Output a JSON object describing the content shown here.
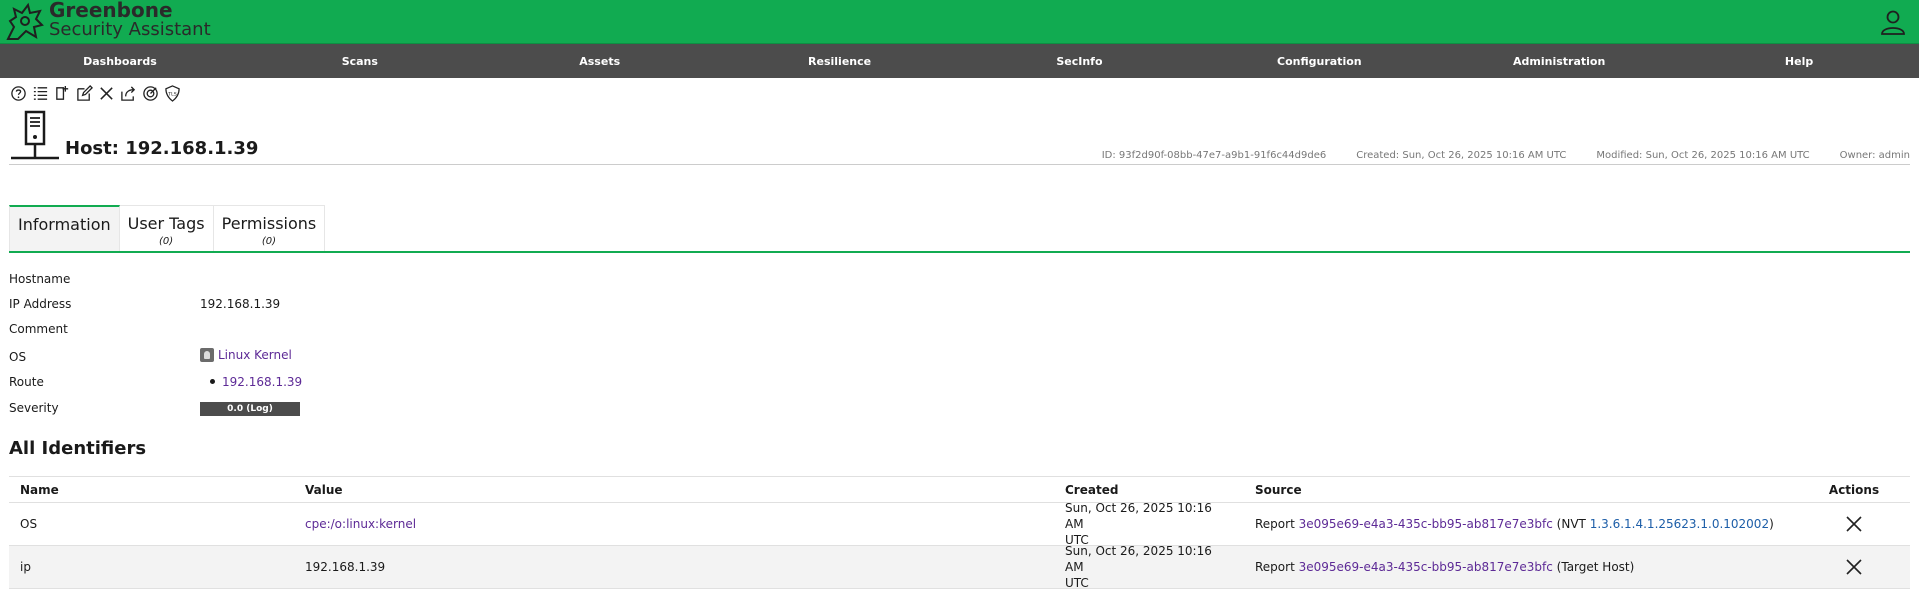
{
  "app": {
    "logo_line1": "Greenbone",
    "logo_line2": "Security Assistant"
  },
  "nav": [
    "Dashboards",
    "Scans",
    "Assets",
    "Resilience",
    "SecInfo",
    "Configuration",
    "Administration",
    "Help"
  ],
  "toolbar": [
    "help-icon",
    "list-icon",
    "new-icon",
    "edit-icon",
    "delete-icon",
    "export-icon",
    "results-icon",
    "tls-certificate-icon"
  ],
  "header": {
    "title": "Host: 192.168.1.39",
    "id": "ID: 93f2d90f-08bb-47e7-a9b1-91f6c44d9de6",
    "created": "Created: Sun, Oct 26, 2025 10:16 AM UTC",
    "modified": "Modified: Sun, Oct 26, 2025 10:16 AM UTC",
    "owner": "Owner: admin"
  },
  "tabs": [
    {
      "label": "Information",
      "count": ""
    },
    {
      "label": "User Tags",
      "count": "(0)"
    },
    {
      "label": "Permissions",
      "count": "(0)"
    }
  ],
  "info": {
    "hostname_label": "Hostname",
    "hostname_value": "",
    "ip_label": "IP Address",
    "ip_value": "192.168.1.39",
    "comment_label": "Comment",
    "comment_value": "",
    "os_label": "OS",
    "os_value": "Linux Kernel",
    "route_label": "Route",
    "route_value": "192.168.1.39",
    "severity_label": "Severity",
    "severity_value": "0.0 (Log)"
  },
  "identifiers": {
    "title": "All Identifiers",
    "columns": {
      "name": "Name",
      "value": "Value",
      "created": "Created",
      "source": "Source",
      "actions": "Actions"
    },
    "rows": [
      {
        "name": "OS",
        "value": "cpe:/o:linux:kernel",
        "created_line1": "Sun, Oct 26, 2025 10:16 AM",
        "created_line2": "UTC",
        "source_prefix": "Report ",
        "source_report": "3e095e69-e4a3-435c-bb95-ab817e7e3bfc",
        "source_mid": " (NVT ",
        "source_nvt": "1.3.6.1.4.1.25623.1.0.102002",
        "source_suffix": ")"
      },
      {
        "name": "ip",
        "value": "192.168.1.39",
        "created_line1": "Sun, Oct 26, 2025 10:16 AM",
        "created_line2": "UTC",
        "source_prefix": "Report ",
        "source_report": "3e095e69-e4a3-435c-bb95-ab817e7e3bfc",
        "source_mid": " (Target Host)",
        "source_nvt": "",
        "source_suffix": ""
      }
    ]
  },
  "colors": {
    "brand_green": "#11ab51",
    "nav_bg": "#4c4c4c",
    "link": "#5d2a96",
    "nvt_link": "#1d5ea8",
    "severity_log": "#4c4c4c"
  }
}
